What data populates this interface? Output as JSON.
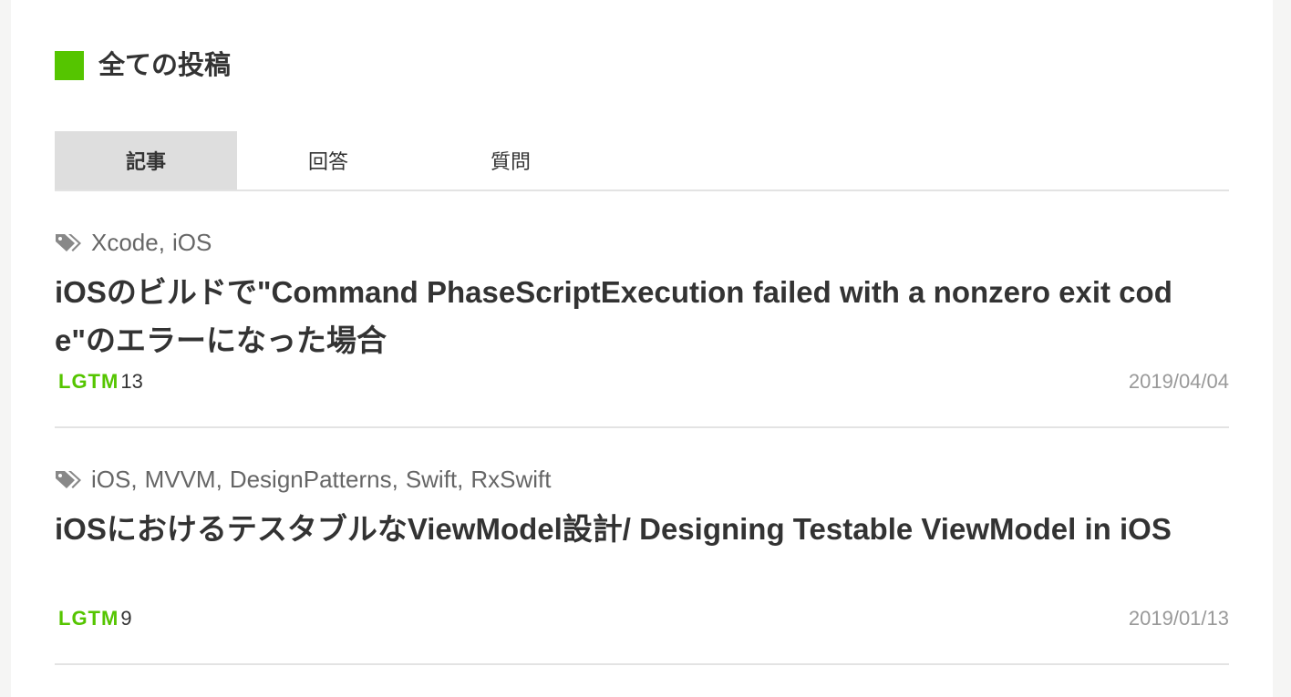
{
  "section": {
    "title": "全ての投稿",
    "accent_color": "#55c500"
  },
  "tabs": [
    {
      "label": "記事",
      "active": true
    },
    {
      "label": "回答",
      "active": false
    },
    {
      "label": "質問",
      "active": false
    }
  ],
  "posts": [
    {
      "tag_icon": "tags-icon",
      "tags": [
        "Xcode",
        "iOS"
      ],
      "title": "iOSのビルドで\"Command PhaseScriptExecution failed with a nonzero exit code\"のエラーになった場合",
      "lgtm_label": "LGTM",
      "lgtm_count": "13",
      "date": "2019/04/04"
    },
    {
      "tag_icon": "tags-icon",
      "tags": [
        "iOS",
        "MVVM",
        "DesignPatterns",
        "Swift",
        "RxSwift"
      ],
      "title": "iOSにおけるテスタブルなViewModel設計/ Designing Testable ViewModel in iOS",
      "lgtm_label": "LGTM",
      "lgtm_count": "9",
      "date": "2019/01/13"
    }
  ]
}
